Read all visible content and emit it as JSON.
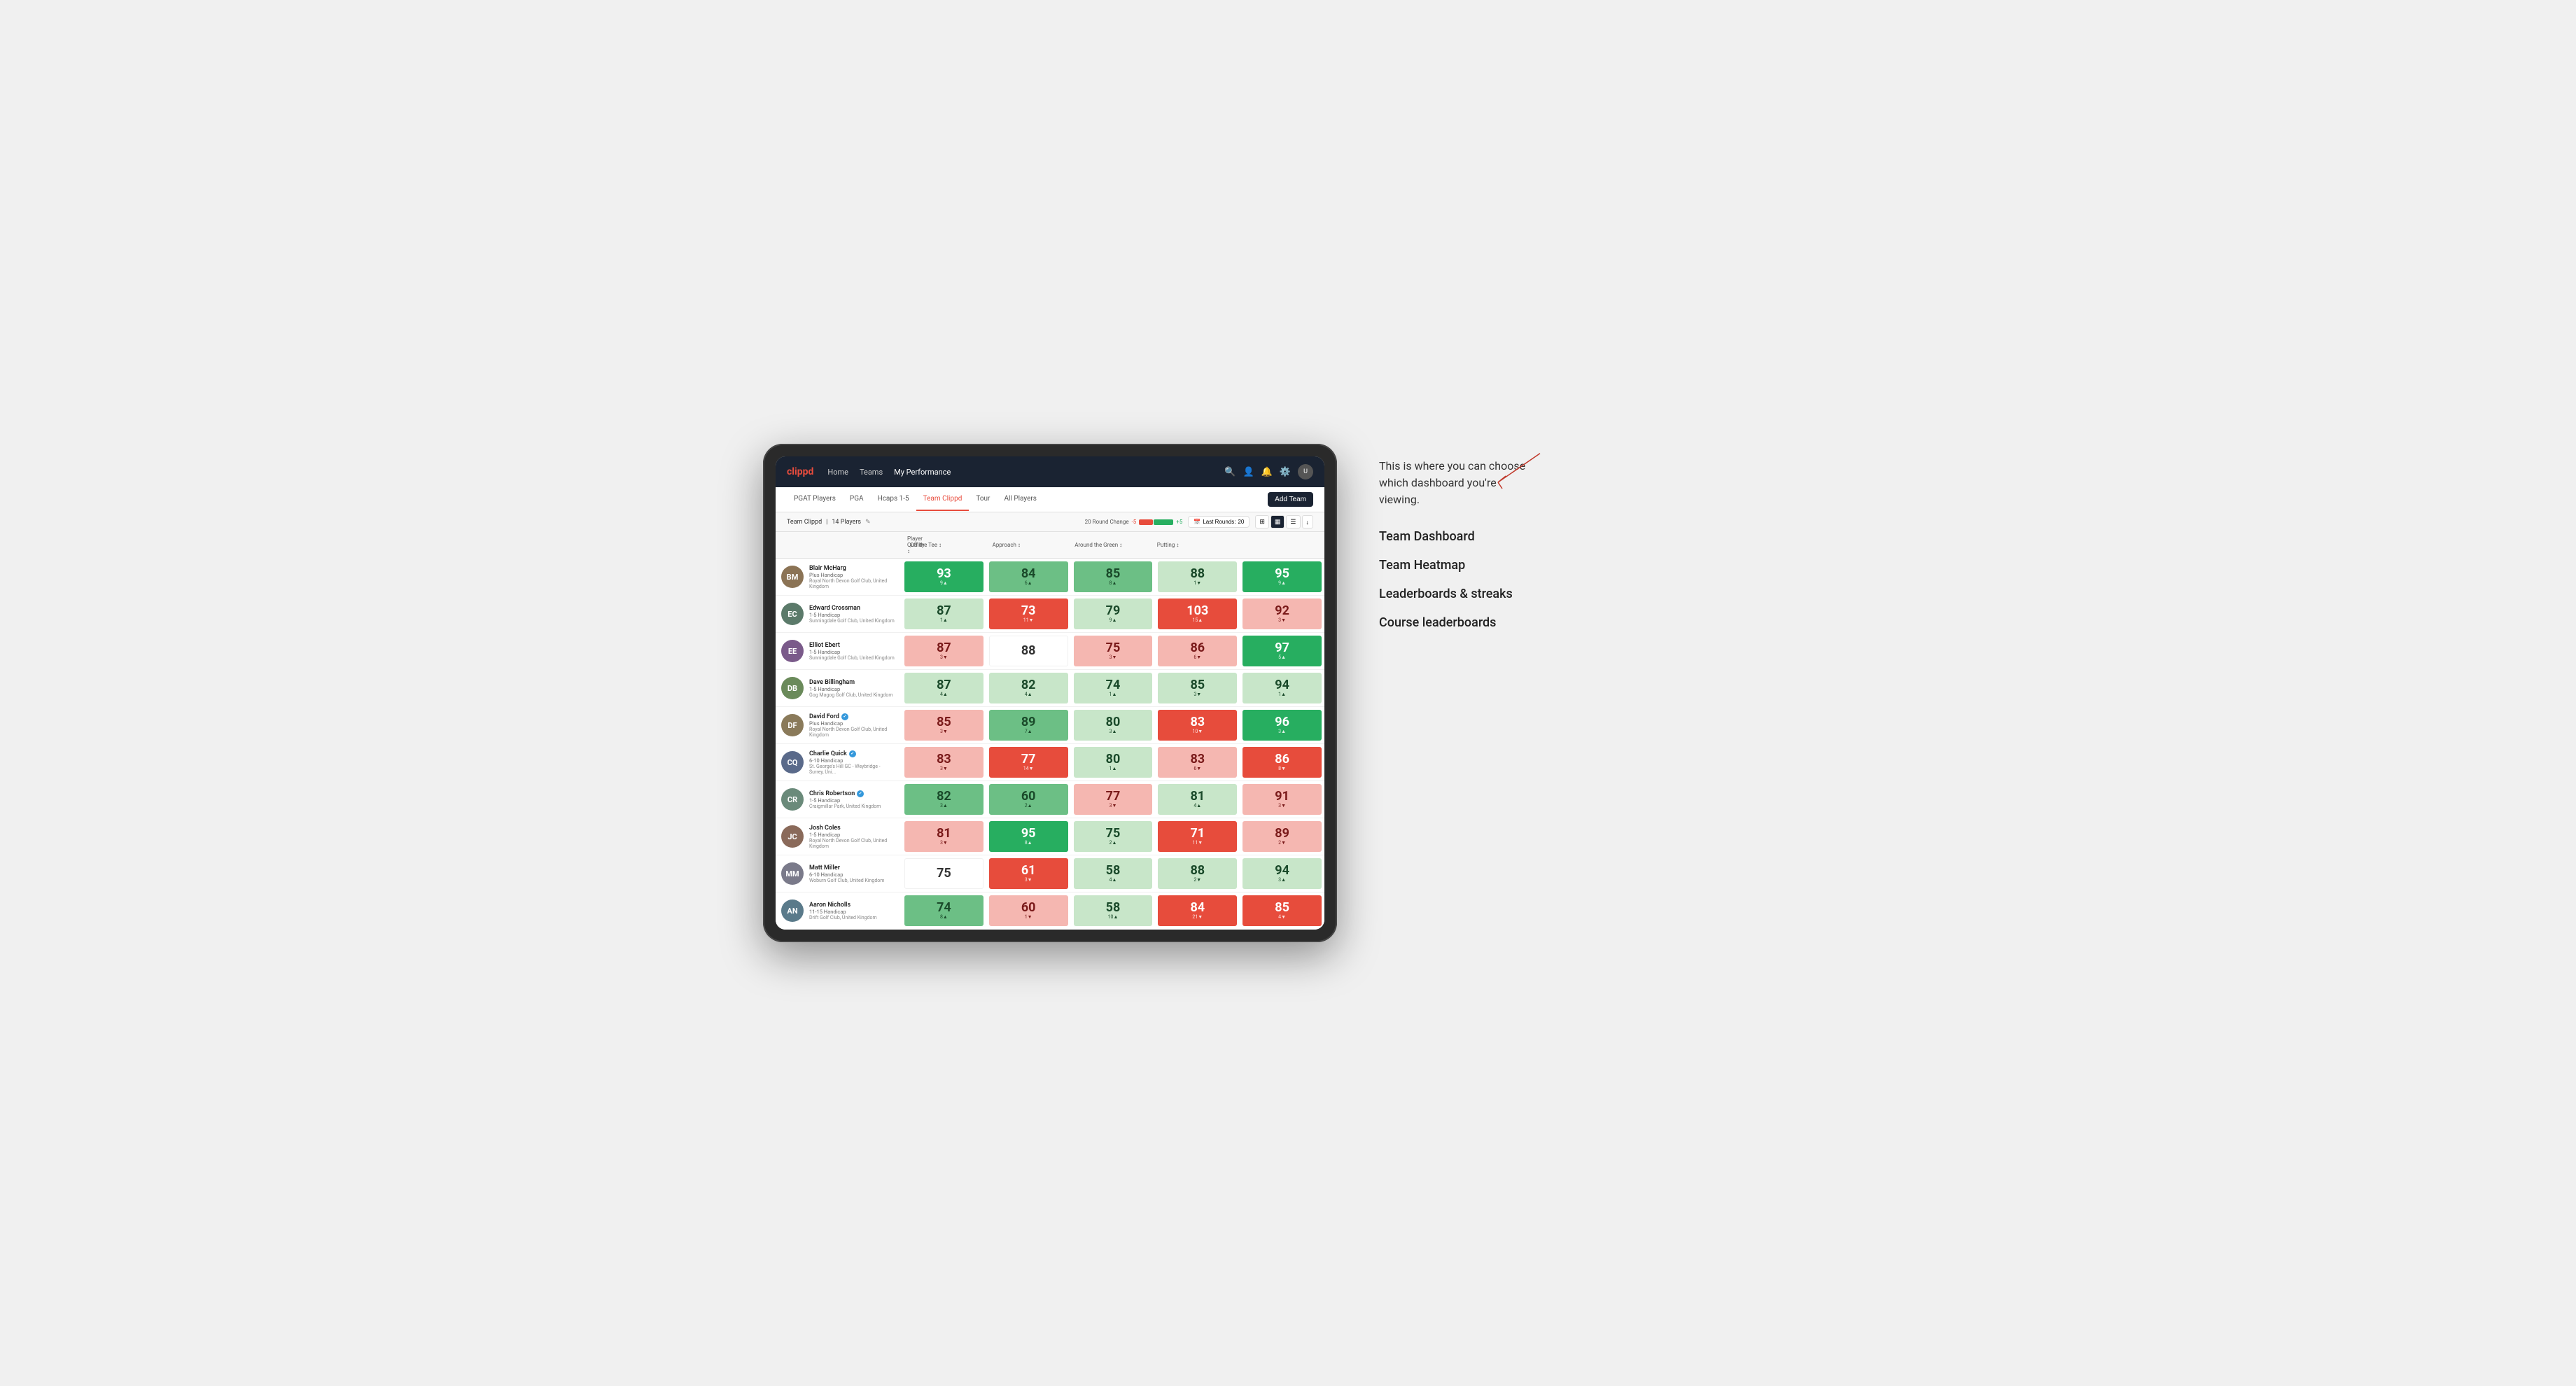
{
  "annotation": {
    "text": "This is where you can choose which dashboard you're viewing.",
    "options": [
      "Team Dashboard",
      "Team Heatmap",
      "Leaderboards & streaks",
      "Course leaderboards"
    ]
  },
  "nav": {
    "logo": "clippd",
    "links": [
      "Home",
      "Teams",
      "My Performance"
    ],
    "active_link": "My Performance"
  },
  "sub_nav": {
    "links": [
      "PGAT Players",
      "PGA",
      "Hcaps 1-5",
      "Team Clippd",
      "Tour",
      "All Players"
    ],
    "active_link": "Team Clippd",
    "add_team_label": "Add Team"
  },
  "team_bar": {
    "team_name": "Team Clippd",
    "player_count": "14 Players",
    "round_change_label": "20 Round Change",
    "change_minus": "-5",
    "change_plus": "+5",
    "last_rounds_label": "Last Rounds:",
    "last_rounds_value": "20"
  },
  "table": {
    "headers": [
      "Player Quality ↕",
      "Off the Tee ↕",
      "Approach ↕",
      "Around the Green ↕",
      "Putting ↕"
    ],
    "players": [
      {
        "name": "Blair McHarg",
        "initials": "BM",
        "handicap": "Plus Handicap",
        "club": "Royal North Devon Golf Club, United Kingdom",
        "avatar_color": "#7a6a5a",
        "stats": [
          {
            "value": "93",
            "change": "9",
            "dir": "up",
            "bg": "dark-green",
            "white": true
          },
          {
            "value": "84",
            "change": "6",
            "dir": "up",
            "bg": "light-green",
            "white": false
          },
          {
            "value": "85",
            "change": "8",
            "dir": "up",
            "bg": "light-green",
            "white": false
          },
          {
            "value": "88",
            "change": "1",
            "dir": "down",
            "bg": "very-light-green",
            "white": false
          },
          {
            "value": "95",
            "change": "9",
            "dir": "up",
            "bg": "dark-green",
            "white": true
          }
        ]
      },
      {
        "name": "Edward Crossman",
        "initials": "EC",
        "handicap": "1-5 Handicap",
        "club": "Sunningdale Golf Club, United Kingdom",
        "avatar_color": "#5a7a6a",
        "stats": [
          {
            "value": "87",
            "change": "1",
            "dir": "up",
            "bg": "very-light-green",
            "white": false
          },
          {
            "value": "73",
            "change": "11",
            "dir": "down",
            "bg": "red",
            "white": true
          },
          {
            "value": "79",
            "change": "9",
            "dir": "up",
            "bg": "very-light-green",
            "white": false
          },
          {
            "value": "103",
            "change": "15",
            "dir": "up",
            "bg": "red",
            "white": true
          },
          {
            "value": "92",
            "change": "3",
            "dir": "down",
            "bg": "light-red",
            "white": false
          }
        ]
      },
      {
        "name": "Elliot Ebert",
        "initials": "EE",
        "handicap": "1-5 Handicap",
        "club": "Sunningdale Golf Club, United Kingdom",
        "avatar_color": "#6a5a7a",
        "stats": [
          {
            "value": "87",
            "change": "3",
            "dir": "down",
            "bg": "light-red",
            "white": false
          },
          {
            "value": "88",
            "change": "",
            "dir": "neutral",
            "bg": "white",
            "white": false
          },
          {
            "value": "75",
            "change": "3",
            "dir": "down",
            "bg": "light-red",
            "white": false
          },
          {
            "value": "86",
            "change": "6",
            "dir": "down",
            "bg": "light-red",
            "white": false
          },
          {
            "value": "97",
            "change": "5",
            "dir": "up",
            "bg": "dark-green",
            "white": true
          }
        ]
      },
      {
        "name": "Dave Billingham",
        "initials": "DB",
        "handicap": "1-5 Handicap",
        "club": "Gog Magog Golf Club, United Kingdom",
        "avatar_color": "#7a8a6a",
        "stats": [
          {
            "value": "87",
            "change": "4",
            "dir": "up",
            "bg": "very-light-green",
            "white": false
          },
          {
            "value": "82",
            "change": "4",
            "dir": "up",
            "bg": "very-light-green",
            "white": false
          },
          {
            "value": "74",
            "change": "1",
            "dir": "up",
            "bg": "very-light-green",
            "white": false
          },
          {
            "value": "85",
            "change": "3",
            "dir": "down",
            "bg": "very-light-green",
            "white": false
          },
          {
            "value": "94",
            "change": "1",
            "dir": "up",
            "bg": "very-light-green",
            "white": false
          }
        ]
      },
      {
        "name": "David Ford",
        "initials": "DF",
        "handicap": "Plus Handicap",
        "club": "Royal North Devon Golf Club, United Kingdom",
        "avatar_color": "#8a7a5a",
        "verified": true,
        "stats": [
          {
            "value": "85",
            "change": "3",
            "dir": "down",
            "bg": "light-red",
            "white": false
          },
          {
            "value": "89",
            "change": "7",
            "dir": "up",
            "bg": "light-green",
            "white": false
          },
          {
            "value": "80",
            "change": "3",
            "dir": "up",
            "bg": "very-light-green",
            "white": false
          },
          {
            "value": "83",
            "change": "10",
            "dir": "down",
            "bg": "red",
            "white": true
          },
          {
            "value": "96",
            "change": "3",
            "dir": "up",
            "bg": "dark-green",
            "white": true
          }
        ]
      },
      {
        "name": "Charlie Quick",
        "initials": "CQ",
        "handicap": "6-10 Handicap",
        "club": "St. George's Hill GC - Weybridge - Surrey, Uni...",
        "avatar_color": "#5a6a8a",
        "verified": true,
        "stats": [
          {
            "value": "83",
            "change": "3",
            "dir": "down",
            "bg": "light-red",
            "white": false
          },
          {
            "value": "77",
            "change": "14",
            "dir": "down",
            "bg": "red",
            "white": true
          },
          {
            "value": "80",
            "change": "1",
            "dir": "up",
            "bg": "very-light-green",
            "white": false
          },
          {
            "value": "83",
            "change": "6",
            "dir": "down",
            "bg": "light-red",
            "white": false
          },
          {
            "value": "86",
            "change": "8",
            "dir": "down",
            "bg": "red",
            "white": true
          }
        ]
      },
      {
        "name": "Chris Robertson",
        "initials": "CR",
        "handicap": "1-5 Handicap",
        "club": "Craigmillar Park, United Kingdom",
        "avatar_color": "#6a8a7a",
        "verified": true,
        "stats": [
          {
            "value": "82",
            "change": "3",
            "dir": "up",
            "bg": "light-green",
            "white": false
          },
          {
            "value": "60",
            "change": "2",
            "dir": "up",
            "bg": "light-green",
            "white": false
          },
          {
            "value": "77",
            "change": "3",
            "dir": "down",
            "bg": "light-red",
            "white": false
          },
          {
            "value": "81",
            "change": "4",
            "dir": "up",
            "bg": "very-light-green",
            "white": false
          },
          {
            "value": "91",
            "change": "3",
            "dir": "down",
            "bg": "light-red",
            "white": false
          }
        ]
      },
      {
        "name": "Josh Coles",
        "initials": "JC",
        "handicap": "1-5 Handicap",
        "club": "Royal North Devon Golf Club, United Kingdom",
        "avatar_color": "#8a6a5a",
        "stats": [
          {
            "value": "81",
            "change": "3",
            "dir": "down",
            "bg": "light-red",
            "white": false
          },
          {
            "value": "95",
            "change": "8",
            "dir": "up",
            "bg": "dark-green",
            "white": true
          },
          {
            "value": "75",
            "change": "2",
            "dir": "up",
            "bg": "very-light-green",
            "white": false
          },
          {
            "value": "71",
            "change": "11",
            "dir": "down",
            "bg": "red",
            "white": true
          },
          {
            "value": "89",
            "change": "2",
            "dir": "down",
            "bg": "light-red",
            "white": false
          }
        ]
      },
      {
        "name": "Matt Miller",
        "initials": "MM",
        "handicap": "6-10 Handicap",
        "club": "Woburn Golf Club, United Kingdom",
        "avatar_color": "#7a7a8a",
        "stats": [
          {
            "value": "75",
            "change": "",
            "dir": "neutral",
            "bg": "white",
            "white": false
          },
          {
            "value": "61",
            "change": "3",
            "dir": "down",
            "bg": "red",
            "white": true
          },
          {
            "value": "58",
            "change": "4",
            "dir": "up",
            "bg": "very-light-green",
            "white": false
          },
          {
            "value": "88",
            "change": "2",
            "dir": "down",
            "bg": "very-light-green",
            "white": false
          },
          {
            "value": "94",
            "change": "3",
            "dir": "up",
            "bg": "very-light-green",
            "white": false
          }
        ]
      },
      {
        "name": "Aaron Nicholls",
        "initials": "AN",
        "handicap": "11-15 Handicap",
        "club": "Drift Golf Club, United Kingdom",
        "avatar_color": "#5a7a8a",
        "stats": [
          {
            "value": "74",
            "change": "8",
            "dir": "up",
            "bg": "light-green",
            "white": false
          },
          {
            "value": "60",
            "change": "1",
            "dir": "down",
            "bg": "light-red",
            "white": false
          },
          {
            "value": "58",
            "change": "10",
            "dir": "up",
            "bg": "very-light-green",
            "white": false
          },
          {
            "value": "84",
            "change": "21",
            "dir": "down",
            "bg": "red",
            "white": true
          },
          {
            "value": "85",
            "change": "4",
            "dir": "down",
            "bg": "red",
            "white": true
          }
        ]
      }
    ]
  }
}
